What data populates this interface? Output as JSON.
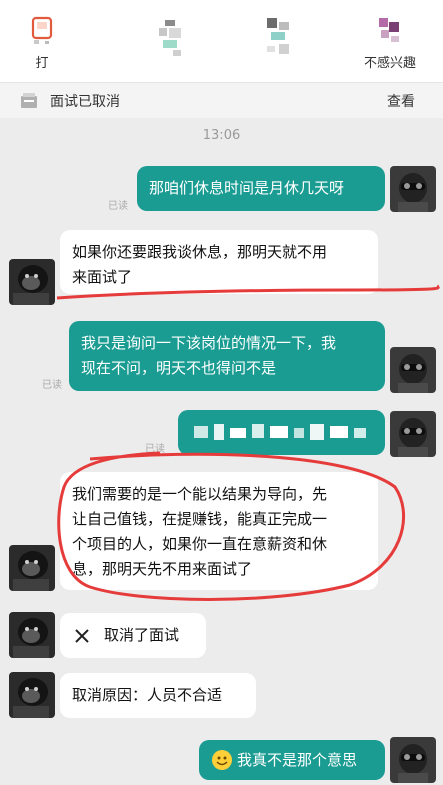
{
  "top_actions": [
    {
      "label": "打",
      "icon": "phone-icon"
    },
    {
      "label": "",
      "icon": "blurred-icon"
    },
    {
      "label": "",
      "icon": "blurred-icon"
    },
    {
      "label": "不感兴趣",
      "icon": "not-interested-icon"
    }
  ],
  "status_bar": {
    "text": "面试已取消",
    "action": "查看"
  },
  "timestamp": "13:06",
  "messages": [
    {
      "side": "out",
      "text": "那咱们休息时间是月休几天呀",
      "read": "已读"
    },
    {
      "side": "in",
      "line1": "如果你还要跟我谈休息，那明天就不用",
      "line2": "来面试了"
    },
    {
      "side": "out",
      "line1": "我只是询问一下该岗位的情况一下，我",
      "line2": "现在不问，明天不也得问不是",
      "read": "已读"
    },
    {
      "side": "out",
      "text": "",
      "read": "已读",
      "blurred": true
    },
    {
      "side": "in",
      "line1": "我们需要的是一个能以结果为导向，先",
      "line2": "让自己值钱，在提赚钱，能真正完成一",
      "line3": "个项目的人，如果你一直在意薪资和休",
      "line4": "息，那明天先不用来面试了"
    },
    {
      "side": "in",
      "icon": "close-icon",
      "text": "取消了面试"
    },
    {
      "side": "in",
      "text": "取消原因：人员不合适"
    },
    {
      "side": "out",
      "icon": "emoji-icon",
      "text": "我真不是那个意思"
    }
  ],
  "colors": {
    "out_bubble": "#1a9c93",
    "in_bubble": "#ffffff",
    "background": "#ececec",
    "annotation": "#e63b3b"
  }
}
